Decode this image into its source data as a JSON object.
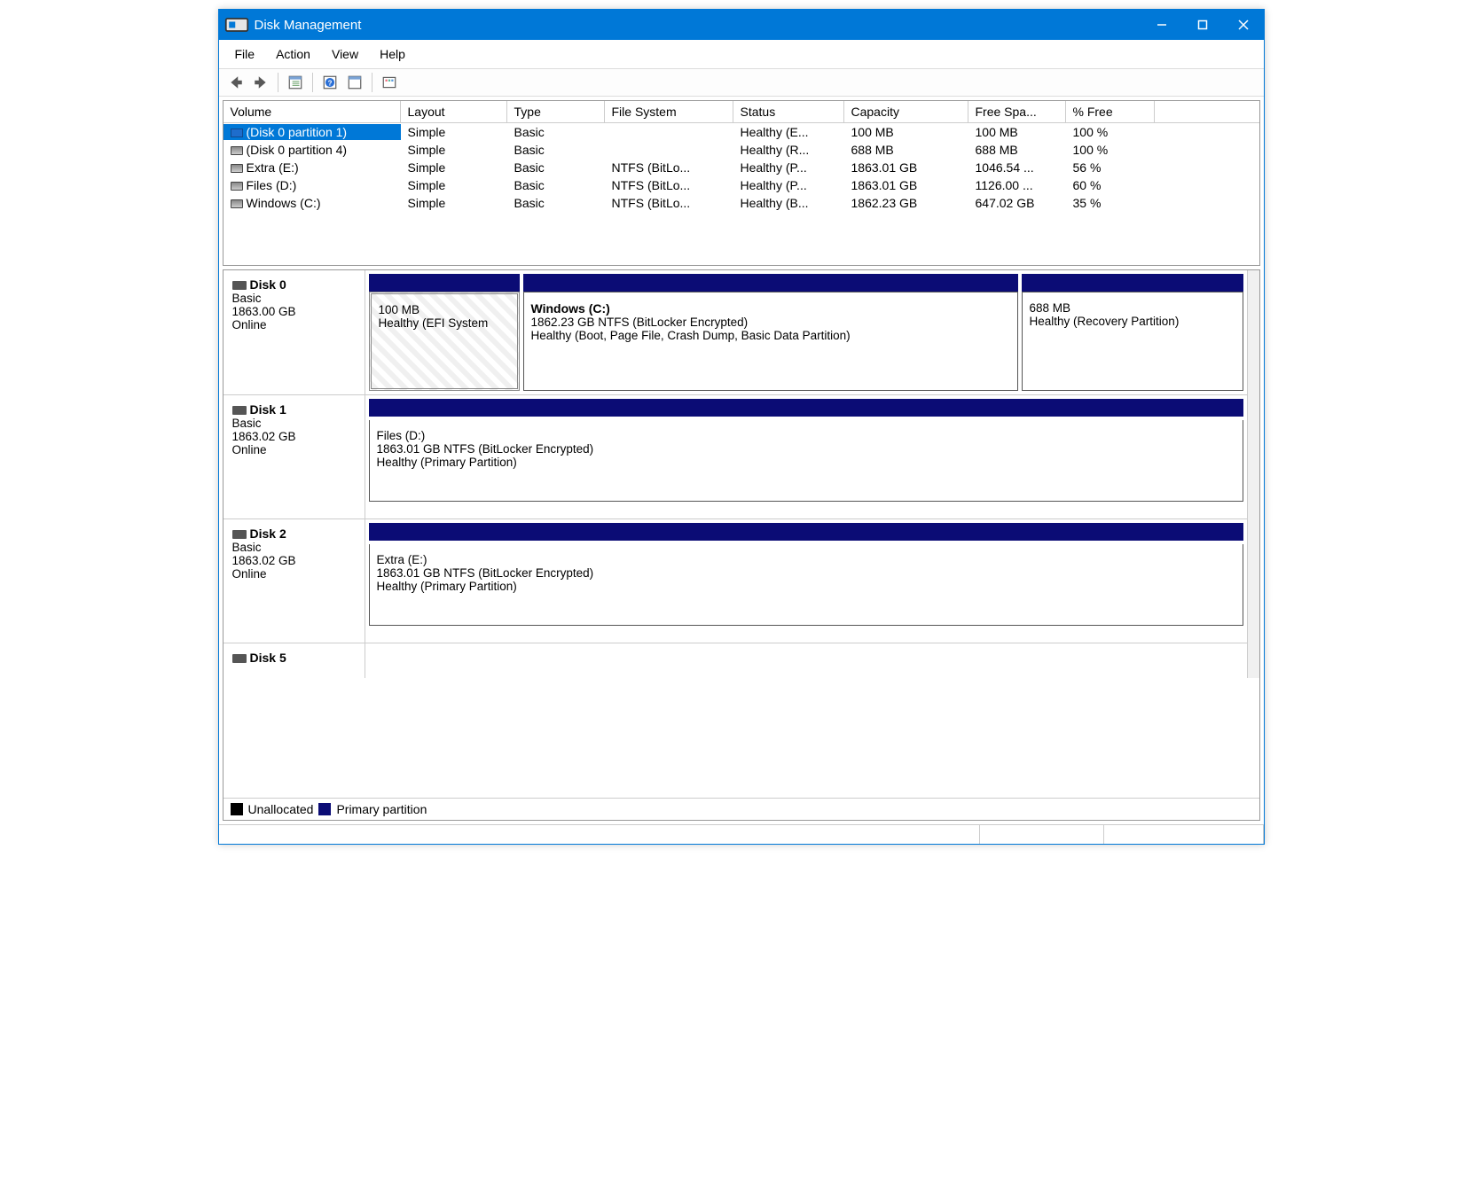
{
  "window_title": "Disk Management",
  "menu": {
    "file": "File",
    "action": "Action",
    "view": "View",
    "help": "Help"
  },
  "vol_headers": [
    "Volume",
    "Layout",
    "Type",
    "File System",
    "Status",
    "Capacity",
    "Free Spa...",
    "% Free"
  ],
  "volumes": [
    {
      "name": "(Disk 0 partition 1)",
      "layout": "Simple",
      "type": "Basic",
      "fs": "",
      "status": "Healthy (E...",
      "capacity": "100 MB",
      "free": "100 MB",
      "pct": "100 %",
      "icon": "blue",
      "selected": true
    },
    {
      "name": "(Disk 0 partition 4)",
      "layout": "Simple",
      "type": "Basic",
      "fs": "",
      "status": "Healthy (R...",
      "capacity": "688 MB",
      "free": "688 MB",
      "pct": "100 %",
      "icon": "drv"
    },
    {
      "name": "Extra (E:)",
      "layout": "Simple",
      "type": "Basic",
      "fs": "NTFS (BitLo...",
      "status": "Healthy (P...",
      "capacity": "1863.01 GB",
      "free": "1046.54 ...",
      "pct": "56 %",
      "icon": "drv"
    },
    {
      "name": "Files (D:)",
      "layout": "Simple",
      "type": "Basic",
      "fs": "NTFS (BitLo...",
      "status": "Healthy (P...",
      "capacity": "1863.01 GB",
      "free": "1126.00 ...",
      "pct": "60 %",
      "icon": "drv"
    },
    {
      "name": "Windows (C:)",
      "layout": "Simple",
      "type": "Basic",
      "fs": "NTFS (BitLo...",
      "status": "Healthy (B...",
      "capacity": "1862.23 GB",
      "free": "647.02 GB",
      "pct": "35 %",
      "icon": "drv"
    }
  ],
  "disks": [
    {
      "name": "Disk 0",
      "type": "Basic",
      "size": "1863.00 GB",
      "state": "Online",
      "parts": [
        {
          "title": "",
          "line1": "100 MB",
          "line2": "Healthy (EFI System",
          "hatched": true,
          "flex": "0 0 170px"
        },
        {
          "title": "Windows  (C:)",
          "line1": "1862.23 GB NTFS (BitLocker Encrypted)",
          "line2": "Healthy (Boot, Page File, Crash Dump, Basic Data Partition)",
          "flex": "1"
        },
        {
          "title": "",
          "line1": "688 MB",
          "line2": "Healthy (Recovery Partition)",
          "flex": "0 0 250px"
        }
      ]
    },
    {
      "name": "Disk 1",
      "type": "Basic",
      "size": "1863.02 GB",
      "state": "Online",
      "single": {
        "title": "Files  (D:)",
        "line1": "1863.01 GB NTFS (BitLocker Encrypted)",
        "line2": "Healthy (Primary Partition)"
      }
    },
    {
      "name": "Disk 2",
      "type": "Basic",
      "size": "1863.02 GB",
      "state": "Online",
      "single": {
        "title": "Extra  (E:)",
        "line1": "1863.01 GB NTFS (BitLocker Encrypted)",
        "line2": "Healthy (Primary Partition)"
      }
    },
    {
      "name": "Disk 5",
      "short": true
    }
  ],
  "legend": {
    "unallocated": "Unallocated",
    "primary": "Primary partition"
  },
  "colors": {
    "accent": "#0078d7",
    "partbar": "#0b0c75"
  }
}
